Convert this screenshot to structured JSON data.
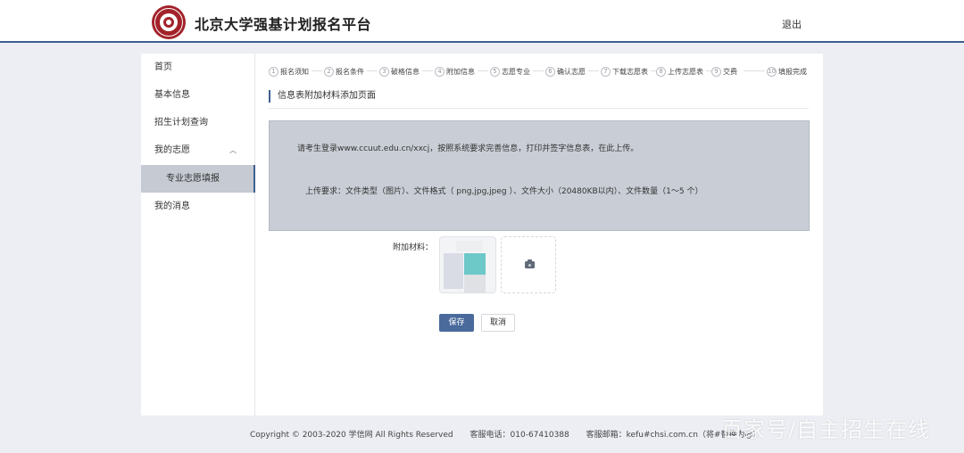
{
  "header": {
    "site_title": "北京大学强基计划报名平台",
    "logout_label": "退出"
  },
  "sidebar": {
    "items": [
      {
        "label": "首页"
      },
      {
        "label": "基本信息"
      },
      {
        "label": "招生计划查询"
      },
      {
        "label": "我的志愿",
        "expanded": true
      },
      {
        "label": "专业志愿填报",
        "active": true
      },
      {
        "label": "我的消息"
      }
    ]
  },
  "steps": [
    {
      "num": "1",
      "label": "报名须知"
    },
    {
      "num": "2",
      "label": "报名条件"
    },
    {
      "num": "3",
      "label": "破格信息"
    },
    {
      "num": "4",
      "label": "附加信息"
    },
    {
      "num": "5",
      "label": "志愿专业"
    },
    {
      "num": "6",
      "label": "确认志愿"
    },
    {
      "num": "7",
      "label": "下载志愿表"
    },
    {
      "num": "8",
      "label": "上传志愿表"
    },
    {
      "num": "9",
      "label": "交费"
    },
    {
      "num": "10",
      "label": "填报完成"
    }
  ],
  "section": {
    "title": "信息表附加材料添加页面"
  },
  "notice": {
    "line1": "请考生登录www.ccuut.edu.cn/xxcj，按照系统要求完善信息，打印并签字信息表，在此上传。",
    "line2": "上传要求：文件类型（图片）、文件格式（ png,jpg,jpeg ）、文件大小（20480KB以内）、文件数量（1～5 个）"
  },
  "attachment": {
    "label": "附加材料："
  },
  "buttons": {
    "save": "保存",
    "cancel": "取消"
  },
  "footer": {
    "copyright": "Copyright © 2003-2020 学信网 All Rights Reserved",
    "phone": "客服电话：010-67410388",
    "email": "客服邮箱：kefu#chsi.com.cn（将#替换为@）"
  },
  "watermark": "百家号/自主招生在线",
  "colors": {
    "accent": "#3e5f8f",
    "logo": "#a3222a",
    "notice_bg": "#c9ced6",
    "save_button": "#4a6a9c"
  }
}
